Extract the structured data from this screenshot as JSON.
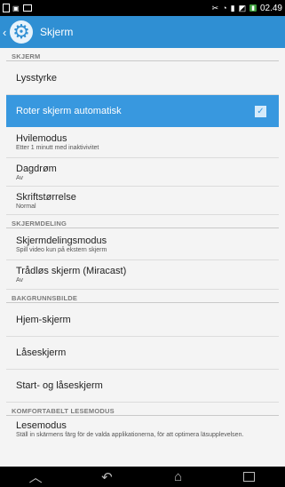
{
  "status_bar": {
    "time": "02.49",
    "left_icons": [
      "file-icon",
      "sim-icon",
      "image-icon"
    ],
    "right_icons": [
      "tools-icon",
      "wifi-icon",
      "signal-icon",
      "no-sim-icon",
      "battery-icon"
    ]
  },
  "action_bar": {
    "title": "Skjerm"
  },
  "sections": {
    "skjerm": "SKJERM",
    "skjermdeling": "SKJERMDELING",
    "bakgrunnsbilde": "BAKGRUNNSBILDE",
    "komfortabelt": "KOMFORTABELT LESEMODUS"
  },
  "items": {
    "lysstyrke": {
      "title": "Lysstyrke"
    },
    "roter": {
      "title": "Roter skjerm automatisk",
      "checked": true
    },
    "hvilemodus": {
      "title": "Hvilemodus",
      "subtitle": "Etter 1 minutt med inaktivivitet"
    },
    "dagdrom": {
      "title": "Dagdrøm",
      "subtitle": "Av"
    },
    "skriftstorrelse": {
      "title": "Skriftstørrelse",
      "subtitle": "Normal"
    },
    "skjermdelingsmodus": {
      "title": "Skjermdelingsmodus",
      "subtitle": "Spill video kun på ekstern skjerm"
    },
    "tradlos": {
      "title": "Trådløs skjerm (Miracast)",
      "subtitle": "Av"
    },
    "hjem": {
      "title": "Hjem-skjerm"
    },
    "laase": {
      "title": "Låseskjerm"
    },
    "start_laase": {
      "title": "Start- og låseskjerm"
    },
    "lesemodus": {
      "title": "Lesemodus",
      "subtitle": "Ställ in skärmens färg för de valda applikationerna, för att optimera läsupplevelsen."
    }
  },
  "colors": {
    "accent": "#2f8fd3",
    "highlight": "#3898df"
  }
}
